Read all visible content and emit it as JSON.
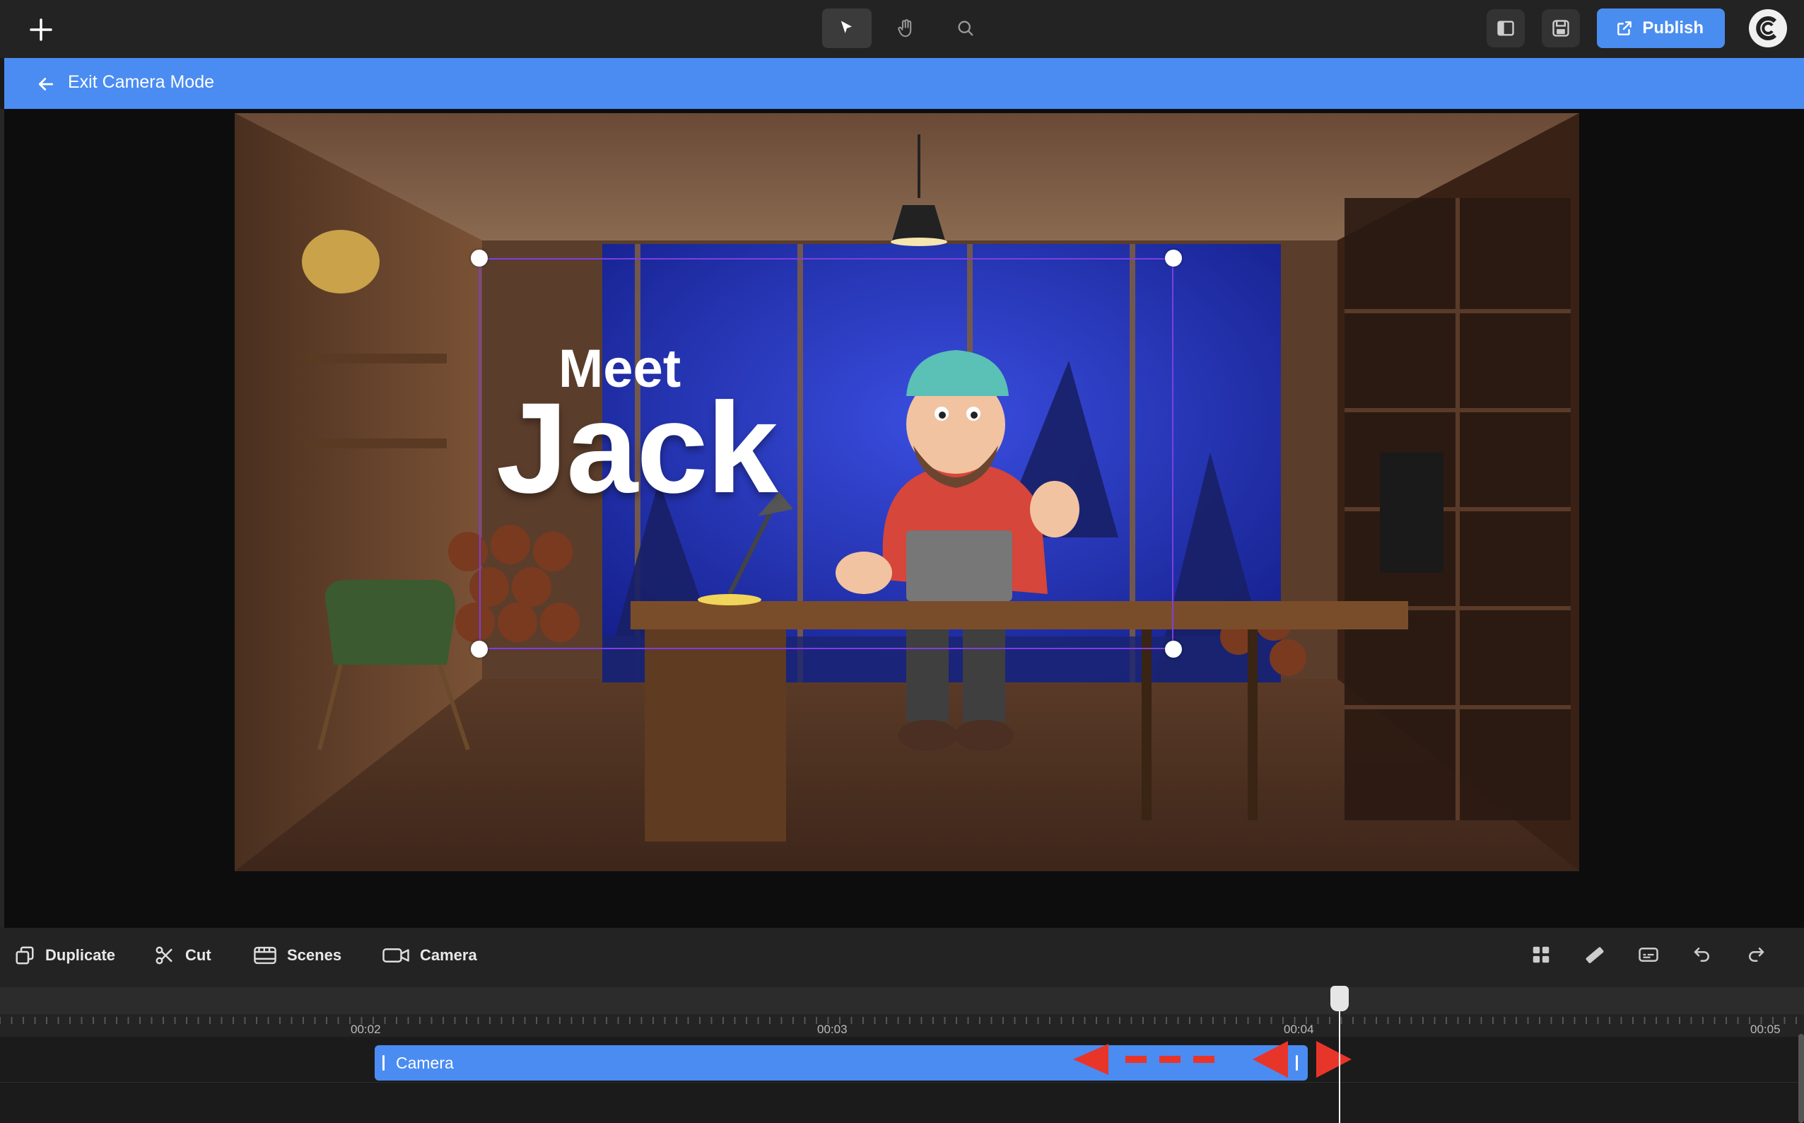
{
  "top_bar": {
    "tools": [
      "select-tool",
      "hand-tool",
      "zoom-tool"
    ],
    "publish_label": "Publish"
  },
  "camera_mode_bar": {
    "exit_label": "Exit Camera Mode"
  },
  "canvas": {
    "title_small": "Meet",
    "title_large": "Jack"
  },
  "toolbar": {
    "duplicate": "Duplicate",
    "cut": "Cut",
    "scenes": "Scenes",
    "camera": "Camera"
  },
  "timeline": {
    "ticks": [
      "00:02",
      "00:03",
      "00:04",
      "00:05"
    ],
    "clip_label": "Camera"
  },
  "colors": {
    "accent": "#4a8cf2",
    "selection": "#7d3fe0",
    "annotation": "#e8352a"
  }
}
